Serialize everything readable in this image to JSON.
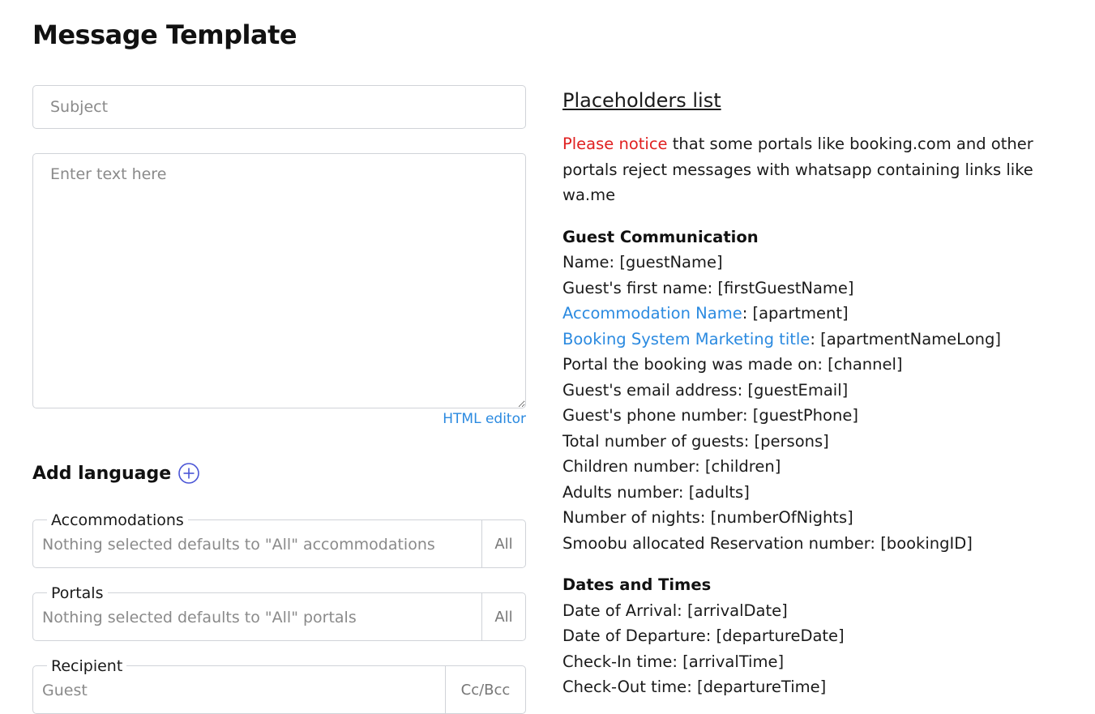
{
  "page": {
    "title": "Message Template"
  },
  "form": {
    "subject_placeholder": "Subject",
    "body_placeholder": "Enter text here",
    "html_editor_label": "HTML editor",
    "add_language_label": "Add language",
    "accommodations": {
      "legend": "Accommodations",
      "value": "Nothing selected defaults to \"All\" accommodations",
      "addon": "All"
    },
    "portals": {
      "legend": "Portals",
      "value": "Nothing selected defaults to \"All\" portals",
      "addon": "All"
    },
    "recipient": {
      "legend": "Recipient",
      "value": "Guest",
      "addon": "Cc/Bcc"
    }
  },
  "placeholders": {
    "title": "Placeholders list",
    "notice_highlight": "Please notice",
    "notice_text": " that some portals like booking.com and other portals reject messages with whatsapp containing links like wa.me",
    "sections": [
      {
        "heading": "Guest Communication",
        "items": [
          {
            "label": "Name",
            "token": "[guestName]",
            "link": false
          },
          {
            "label": "Guest's first name",
            "token": "[firstGuestName]",
            "link": false
          },
          {
            "label": "Accommodation Name",
            "token": "[apartment]",
            "link": true
          },
          {
            "label": "Booking System Marketing title",
            "token": "[apartmentNameLong]",
            "link": true
          },
          {
            "label": "Portal the booking was made on",
            "token": "[channel]",
            "link": false
          },
          {
            "label": "Guest's email address",
            "token": "[guestEmail]",
            "link": false
          },
          {
            "label": "Guest's phone number",
            "token": "[guestPhone]",
            "link": false
          },
          {
            "label": "Total number of guests",
            "token": "[persons]",
            "link": false
          },
          {
            "label": "Children number",
            "token": "[children]",
            "link": false
          },
          {
            "label": "Adults number",
            "token": "[adults]",
            "link": false
          },
          {
            "label": "Number of nights",
            "token": "[numberOfNights]",
            "link": false
          },
          {
            "label": "Smoobu allocated Reservation number",
            "token": "[bookingID]",
            "link": false
          }
        ]
      },
      {
        "heading": "Dates and Times",
        "items": [
          {
            "label": "Date of Arrival",
            "token": "[arrivalDate]",
            "link": false
          },
          {
            "label": "Date of Departure",
            "token": "[departureDate]",
            "link": false
          },
          {
            "label": "Check-In time",
            "token": "[arrivalTime]",
            "link": false
          },
          {
            "label": "Check-Out time",
            "token": "[departureTime]",
            "link": false
          }
        ]
      }
    ]
  },
  "colors": {
    "link": "#2b8ae0",
    "notice": "#e02020",
    "add_icon": "#4a55d6",
    "border": "#d0d3d8"
  },
  "icons": {
    "add_language": "plus-circle-icon",
    "resize": "resize-handle-icon"
  }
}
